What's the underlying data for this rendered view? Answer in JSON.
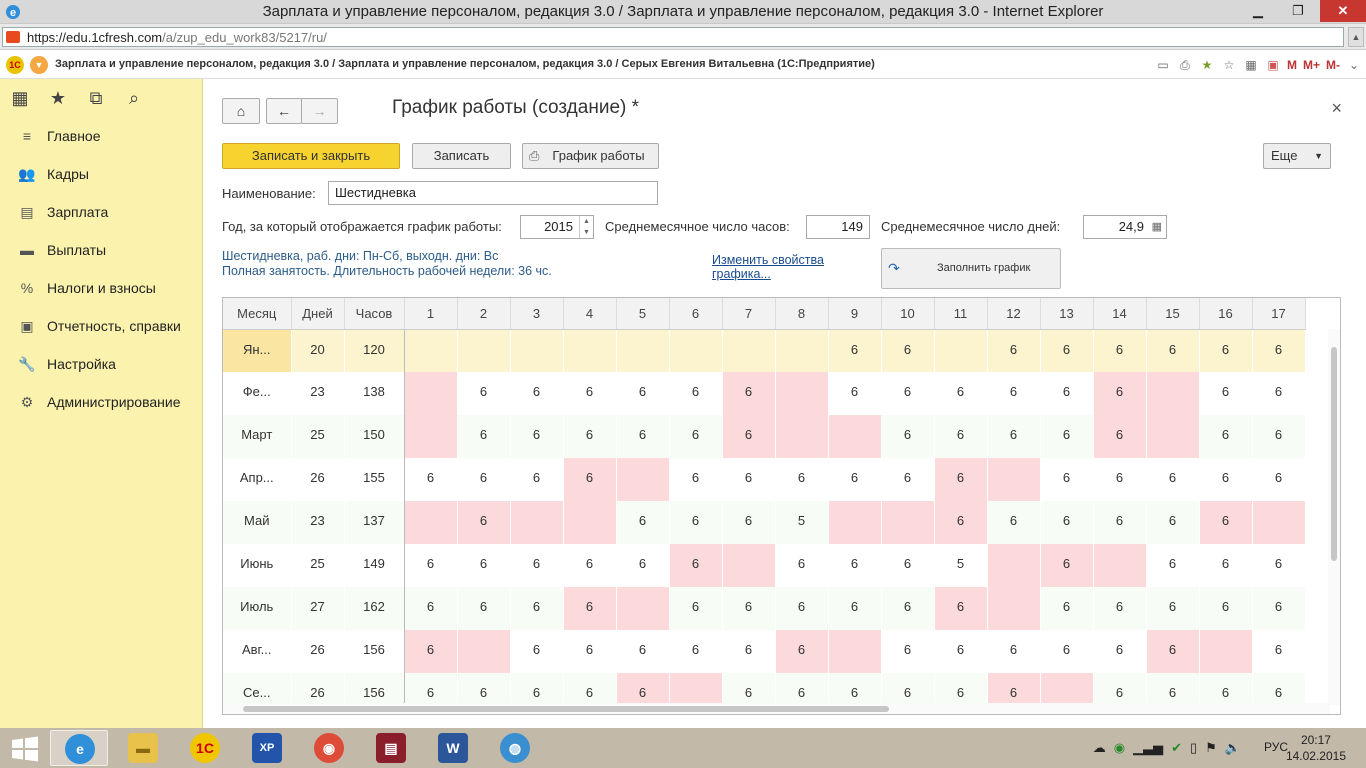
{
  "window": {
    "title": "Зарплата и управление персоналом, редакция 3.0 / Зарплата и управление персоналом, редакция 3.0 - Internet Explorer",
    "min": "▁",
    "max": "❐",
    "close": "✕"
  },
  "address": {
    "url_main": "https://edu.1cfresh.com",
    "url_rest": "/a/zup_edu_work83/5217/ru/"
  },
  "appbar": {
    "title": "Зарплата и управление персоналом, редакция 3.0 / Зарплата и управление персоналом, редакция 3.0 / Серых Евгения Витальевна  (1С:Предприятие)",
    "m": "M",
    "mplus": "M+",
    "mminus": "M-"
  },
  "sidebar": {
    "items": [
      {
        "label": "Главное",
        "icon": "≡"
      },
      {
        "label": "Кадры",
        "icon": "👥"
      },
      {
        "label": "Зарплата",
        "icon": "▤"
      },
      {
        "label": "Выплаты",
        "icon": "▬"
      },
      {
        "label": "Налоги и взносы",
        "icon": "%"
      },
      {
        "label": "Отчетность, справки",
        "icon": "▣"
      },
      {
        "label": "Настройка",
        "icon": "🔧"
      },
      {
        "label": "Администрирование",
        "icon": "⚙"
      }
    ]
  },
  "form": {
    "title": "График работы (создание) *",
    "btn_save_close": "Записать и закрыть",
    "btn_save": "Записать",
    "btn_schedule": "График работы",
    "btn_more": "Еще",
    "name_label": "Наименование:",
    "name_value": "Шестидневка",
    "year_label": "Год, за который отображается график работы:",
    "year_value": "2015",
    "avg_hours_label": "Среднемесячное число часов:",
    "avg_hours_value": "149",
    "avg_days_label": "Среднемесячное число дней:",
    "avg_days_value": "24,9",
    "info_line1": "Шестидневка, раб. дни: Пн-Сб, выходн. дни: Вс",
    "info_line2": "Полная занятость. Длительность рабочей недели: 36 чс.",
    "link_change": "Изменить свойства графика...",
    "fill_button": "Заполнить график"
  },
  "grid": {
    "headers": [
      "Месяц",
      "Дней",
      "Часов",
      "1",
      "2",
      "3",
      "4",
      "5",
      "6",
      "7",
      "8",
      "9",
      "10",
      "11",
      "12",
      "13",
      "14",
      "15",
      "16",
      "17"
    ],
    "rows": [
      {
        "month": "Ян...",
        "days": "20",
        "hours": "120",
        "cells": [
          "",
          "",
          "",
          "",
          "",
          "",
          "",
          "",
          "6",
          "6",
          "",
          "6",
          "6",
          "6",
          "6",
          "6",
          "6"
        ],
        "off": [],
        "selected": true
      },
      {
        "month": "Фе...",
        "days": "23",
        "hours": "138",
        "cells": [
          "",
          "6",
          "6",
          "6",
          "6",
          "6",
          "6",
          "",
          "6",
          "6",
          "6",
          "6",
          "6",
          "6",
          "",
          "6",
          "6"
        ],
        "off": [
          1,
          7,
          8,
          14,
          15
        ]
      },
      {
        "month": "Март",
        "days": "25",
        "hours": "150",
        "cells": [
          "",
          "6",
          "6",
          "6",
          "6",
          "6",
          "6",
          "",
          "",
          "6",
          "6",
          "6",
          "6",
          "6",
          "",
          "6",
          "6"
        ],
        "off": [
          1,
          7,
          8,
          9,
          14,
          15
        ]
      },
      {
        "month": "Апр...",
        "days": "26",
        "hours": "155",
        "cells": [
          "6",
          "6",
          "6",
          "6",
          "",
          "6",
          "6",
          "6",
          "6",
          "6",
          "6",
          "",
          "6",
          "6",
          "6",
          "6",
          "6"
        ],
        "off": [
          4,
          5,
          11,
          12
        ]
      },
      {
        "month": "Май",
        "days": "23",
        "hours": "137",
        "cells": [
          "",
          "6",
          "",
          "",
          "6",
          "6",
          "6",
          "5",
          "",
          "",
          "6",
          "6",
          "6",
          "6",
          "6",
          "6",
          ""
        ],
        "off": [
          1,
          2,
          3,
          4,
          9,
          10,
          11,
          16,
          17
        ]
      },
      {
        "month": "Июнь",
        "days": "25",
        "hours": "149",
        "cells": [
          "6",
          "6",
          "6",
          "6",
          "6",
          "6",
          "",
          "6",
          "6",
          "6",
          "5",
          "",
          "6",
          "",
          "6",
          "6",
          "6"
        ],
        "off": [
          6,
          7,
          12,
          13,
          14
        ]
      },
      {
        "month": "Июль",
        "days": "27",
        "hours": "162",
        "cells": [
          "6",
          "6",
          "6",
          "6",
          "",
          "6",
          "6",
          "6",
          "6",
          "6",
          "6",
          "",
          "6",
          "6",
          "6",
          "6",
          "6"
        ],
        "off": [
          4,
          5,
          11,
          12
        ]
      },
      {
        "month": "Авг...",
        "days": "26",
        "hours": "156",
        "cells": [
          "6",
          "",
          "6",
          "6",
          "6",
          "6",
          "6",
          "6",
          "",
          "6",
          "6",
          "6",
          "6",
          "6",
          "6",
          "",
          "6"
        ],
        "off": [
          1,
          2,
          8,
          9,
          15,
          16
        ]
      },
      {
        "month": "Се...",
        "days": "26",
        "hours": "156",
        "cells": [
          "6",
          "6",
          "6",
          "6",
          "6",
          "",
          "6",
          "6",
          "6",
          "6",
          "6",
          "6",
          "",
          "6",
          "6",
          "6",
          "6"
        ],
        "off": [
          5,
          6,
          12,
          13
        ]
      }
    ]
  },
  "taskbar": {
    "lang": "РУС",
    "time": "20:17",
    "date": "14.02.2015"
  }
}
